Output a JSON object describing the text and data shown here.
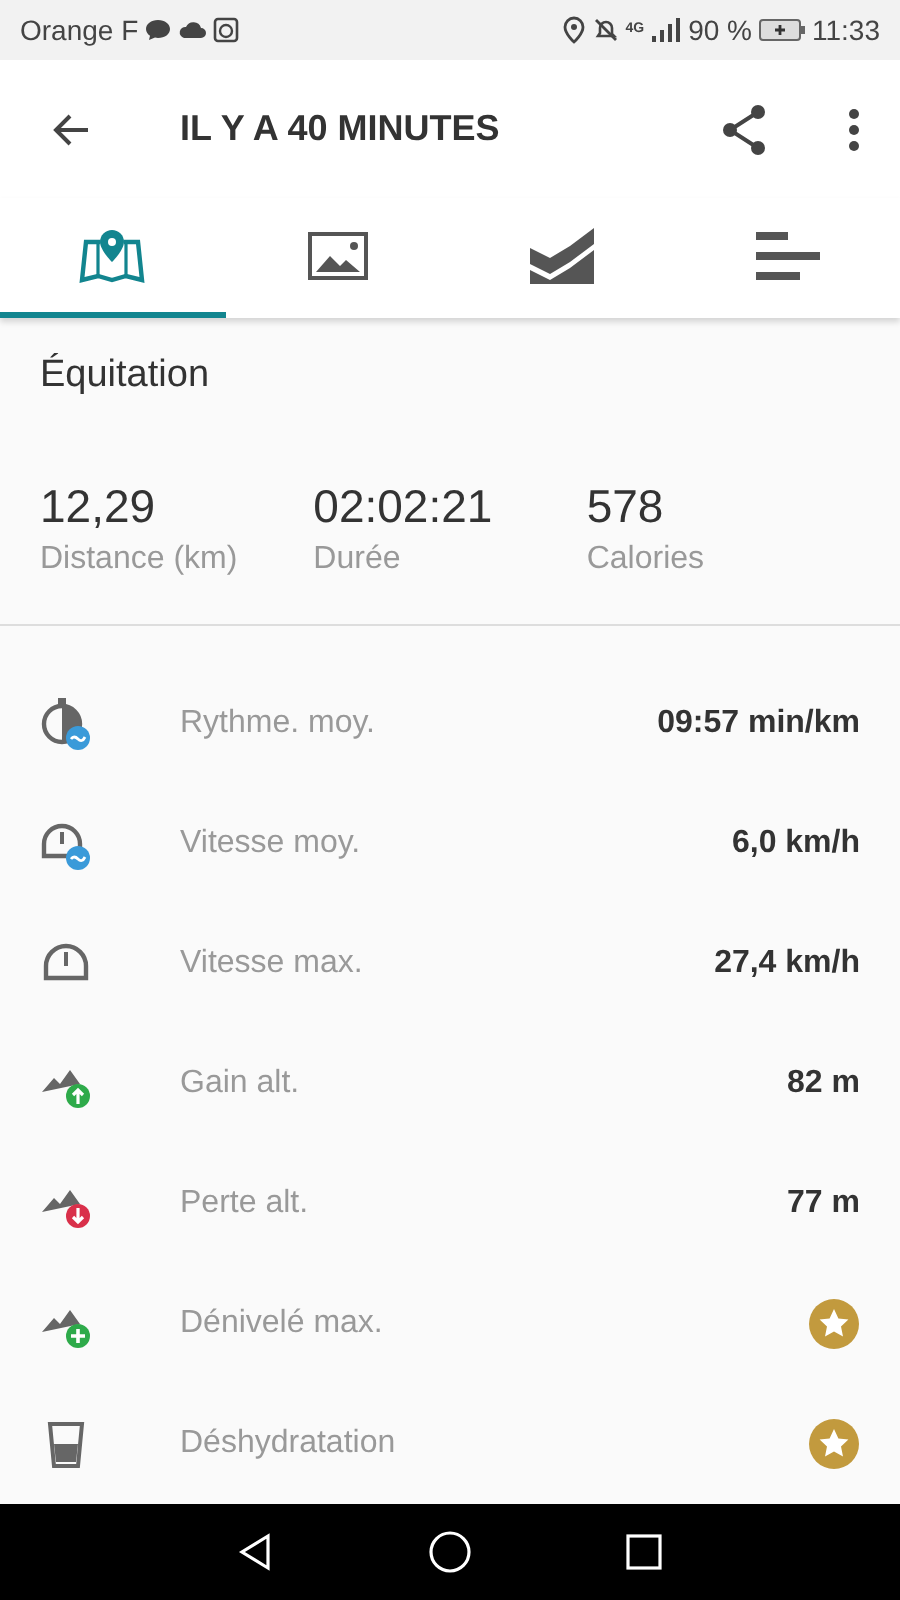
{
  "status_bar": {
    "carrier": "Orange F",
    "network": "4G",
    "battery": "90 %",
    "time": "11:33"
  },
  "toolbar": {
    "title": "IL Y A 40 MINUTES"
  },
  "tabs": [
    {
      "selected": true
    },
    {
      "selected": false
    },
    {
      "selected": false
    },
    {
      "selected": false
    }
  ],
  "sport": "Équitation",
  "summary": [
    {
      "value": "12,29",
      "label": "Distance (km)"
    },
    {
      "value": "02:02:21",
      "label": "Durée"
    },
    {
      "value": "578",
      "label": "Calories"
    }
  ],
  "metrics": [
    {
      "label": "Rythme. moy.",
      "kind": "value",
      "value": "09:57 min/km"
    },
    {
      "label": "Vitesse moy.",
      "kind": "value",
      "value": "6,0 km/h"
    },
    {
      "label": "Vitesse max.",
      "kind": "value",
      "value": "27,4 km/h"
    },
    {
      "label": "Gain alt.",
      "kind": "value",
      "value": "82 m"
    },
    {
      "label": "Perte alt.",
      "kind": "value",
      "value": "77 m"
    },
    {
      "label": "Dénivelé max.",
      "kind": "premium"
    },
    {
      "label": "Déshydratation",
      "kind": "premium"
    }
  ]
}
